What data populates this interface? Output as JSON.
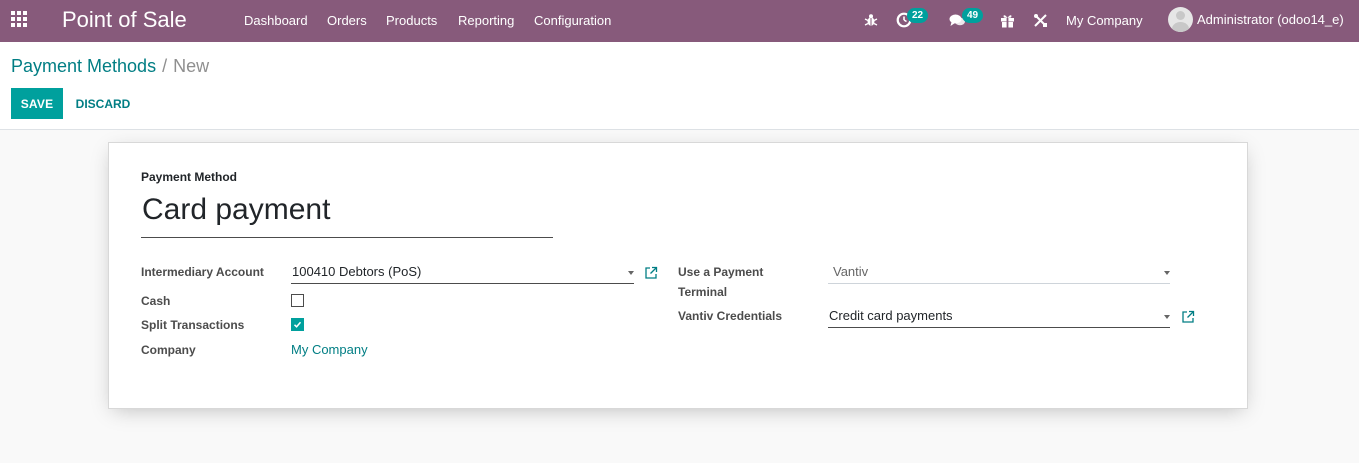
{
  "navbar": {
    "app_title": "Point of Sale",
    "menu": [
      "Dashboard",
      "Orders",
      "Products",
      "Reporting",
      "Configuration"
    ],
    "activity_count": "22",
    "messages_count": "49",
    "company": "My Company",
    "user": "Administrator (odoo14_e)",
    "icons": [
      "apps-icon",
      "bug-icon",
      "activity-clock-icon",
      "chat-icon",
      "gift-icon",
      "tools-icon"
    ]
  },
  "breadcrumb": {
    "parent": "Payment Methods",
    "separator": "/",
    "current": "New"
  },
  "actions": {
    "save": "SAVE",
    "discard": "DISCARD"
  },
  "form": {
    "name_label": "Payment Method",
    "name_value": "Card payment",
    "intermediary_account": {
      "label": "Intermediary Account",
      "value": "100410 Debtors (PoS)"
    },
    "cash": {
      "label": "Cash",
      "checked": false
    },
    "split_transactions": {
      "label": "Split Transactions",
      "checked": true
    },
    "company": {
      "label": "Company",
      "value": "My Company"
    },
    "terminal": {
      "label_line1": "Use a Payment",
      "label_line2": "Terminal",
      "value": "Vantiv"
    },
    "vantiv_credentials": {
      "label": "Vantiv Credentials",
      "value": "Credit card payments"
    }
  },
  "colors": {
    "navbar": "#875a7b",
    "primary": "#00a09d",
    "link": "#017e84"
  }
}
